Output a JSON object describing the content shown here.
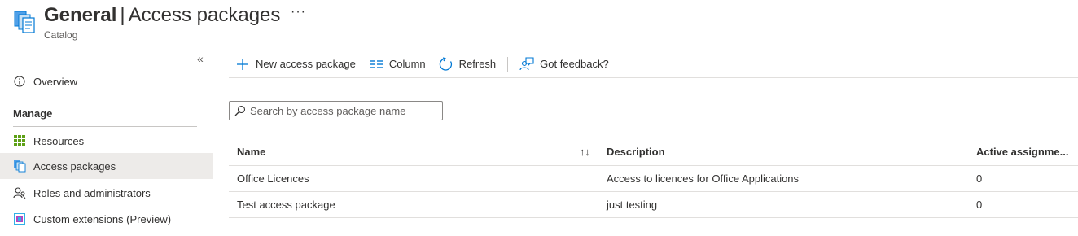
{
  "header": {
    "title_strong": "General",
    "title_sep": "|",
    "title_light": "Access packages",
    "more": "···",
    "subtitle": "Catalog",
    "icon": "access-package-icon"
  },
  "sidebar": {
    "collapse": "«",
    "section_label": "Manage",
    "items": [
      {
        "label": "Overview",
        "icon": "info-icon"
      },
      {
        "label": "Resources",
        "icon": "grid-icon"
      },
      {
        "label": "Access packages",
        "icon": "access-package-icon",
        "active": true
      },
      {
        "label": "Roles and administrators",
        "icon": "people-icon"
      },
      {
        "label": "Custom extensions (Preview)",
        "icon": "extension-icon"
      }
    ]
  },
  "commands": [
    {
      "label": "New access package",
      "icon": "plus-icon"
    },
    {
      "label": "Column",
      "icon": "columns-icon"
    },
    {
      "label": "Refresh",
      "icon": "refresh-icon"
    },
    {
      "label": "Got feedback?",
      "icon": "feedback-icon"
    }
  ],
  "search": {
    "placeholder": "Search by access package name",
    "value": ""
  },
  "table": {
    "columns": [
      "Name",
      "Description",
      "Active assignme..."
    ],
    "sort_glyph": "↑↓",
    "rows": [
      [
        "Office Licences",
        "Access to licences for Office Applications",
        "0"
      ],
      [
        "Test access package",
        "just testing",
        "0"
      ]
    ]
  },
  "colors": {
    "accent": "#0078d4",
    "active_bg": "#edebe9",
    "text": "#323130"
  }
}
